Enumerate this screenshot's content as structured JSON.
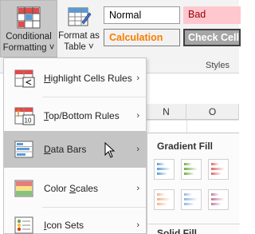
{
  "ribbon": {
    "conditional_formatting": {
      "line1": "Conditional",
      "line2": "Formatting ˅"
    },
    "format_as_table": {
      "line1": "Format as",
      "line2": "Table ˅"
    },
    "styles": {
      "normal": "Normal",
      "bad": "Bad",
      "calculation": "Calculation",
      "check_cell": "Check Cell",
      "group_label": "Styles"
    }
  },
  "sheet": {
    "columns": [
      "N",
      "O"
    ]
  },
  "menu": {
    "items": [
      {
        "label": "Highlight Cells Rules",
        "mnemonic": "H",
        "rest": "ighlight Cells Rules",
        "icon": "highlight-cells-icon"
      },
      {
        "label": "Top/Bottom Rules",
        "mnemonic": "T",
        "rest": "op/Bottom Rules",
        "icon": "top-bottom-icon"
      },
      {
        "label": "Data Bars",
        "mnemonic": "D",
        "rest": "ata Bars",
        "icon": "data-bars-icon"
      },
      {
        "label": "Color Scales",
        "mnemonic": "S",
        "pre": "Color ",
        "rest": "cales",
        "icon": "color-scales-icon"
      },
      {
        "label": "Icon Sets",
        "mnemonic": "I",
        "rest": "con Sets",
        "icon": "icon-sets-icon"
      }
    ],
    "arrow": "›"
  },
  "submenu": {
    "gradient_header": "Gradient Fill",
    "solid_header": "Solid Fill",
    "gradient_colors": [
      "#5b9bd5",
      "#70ad47",
      "#e06666",
      "#f4b183",
      "#8fb4e3",
      "#c27ba0"
    ]
  }
}
